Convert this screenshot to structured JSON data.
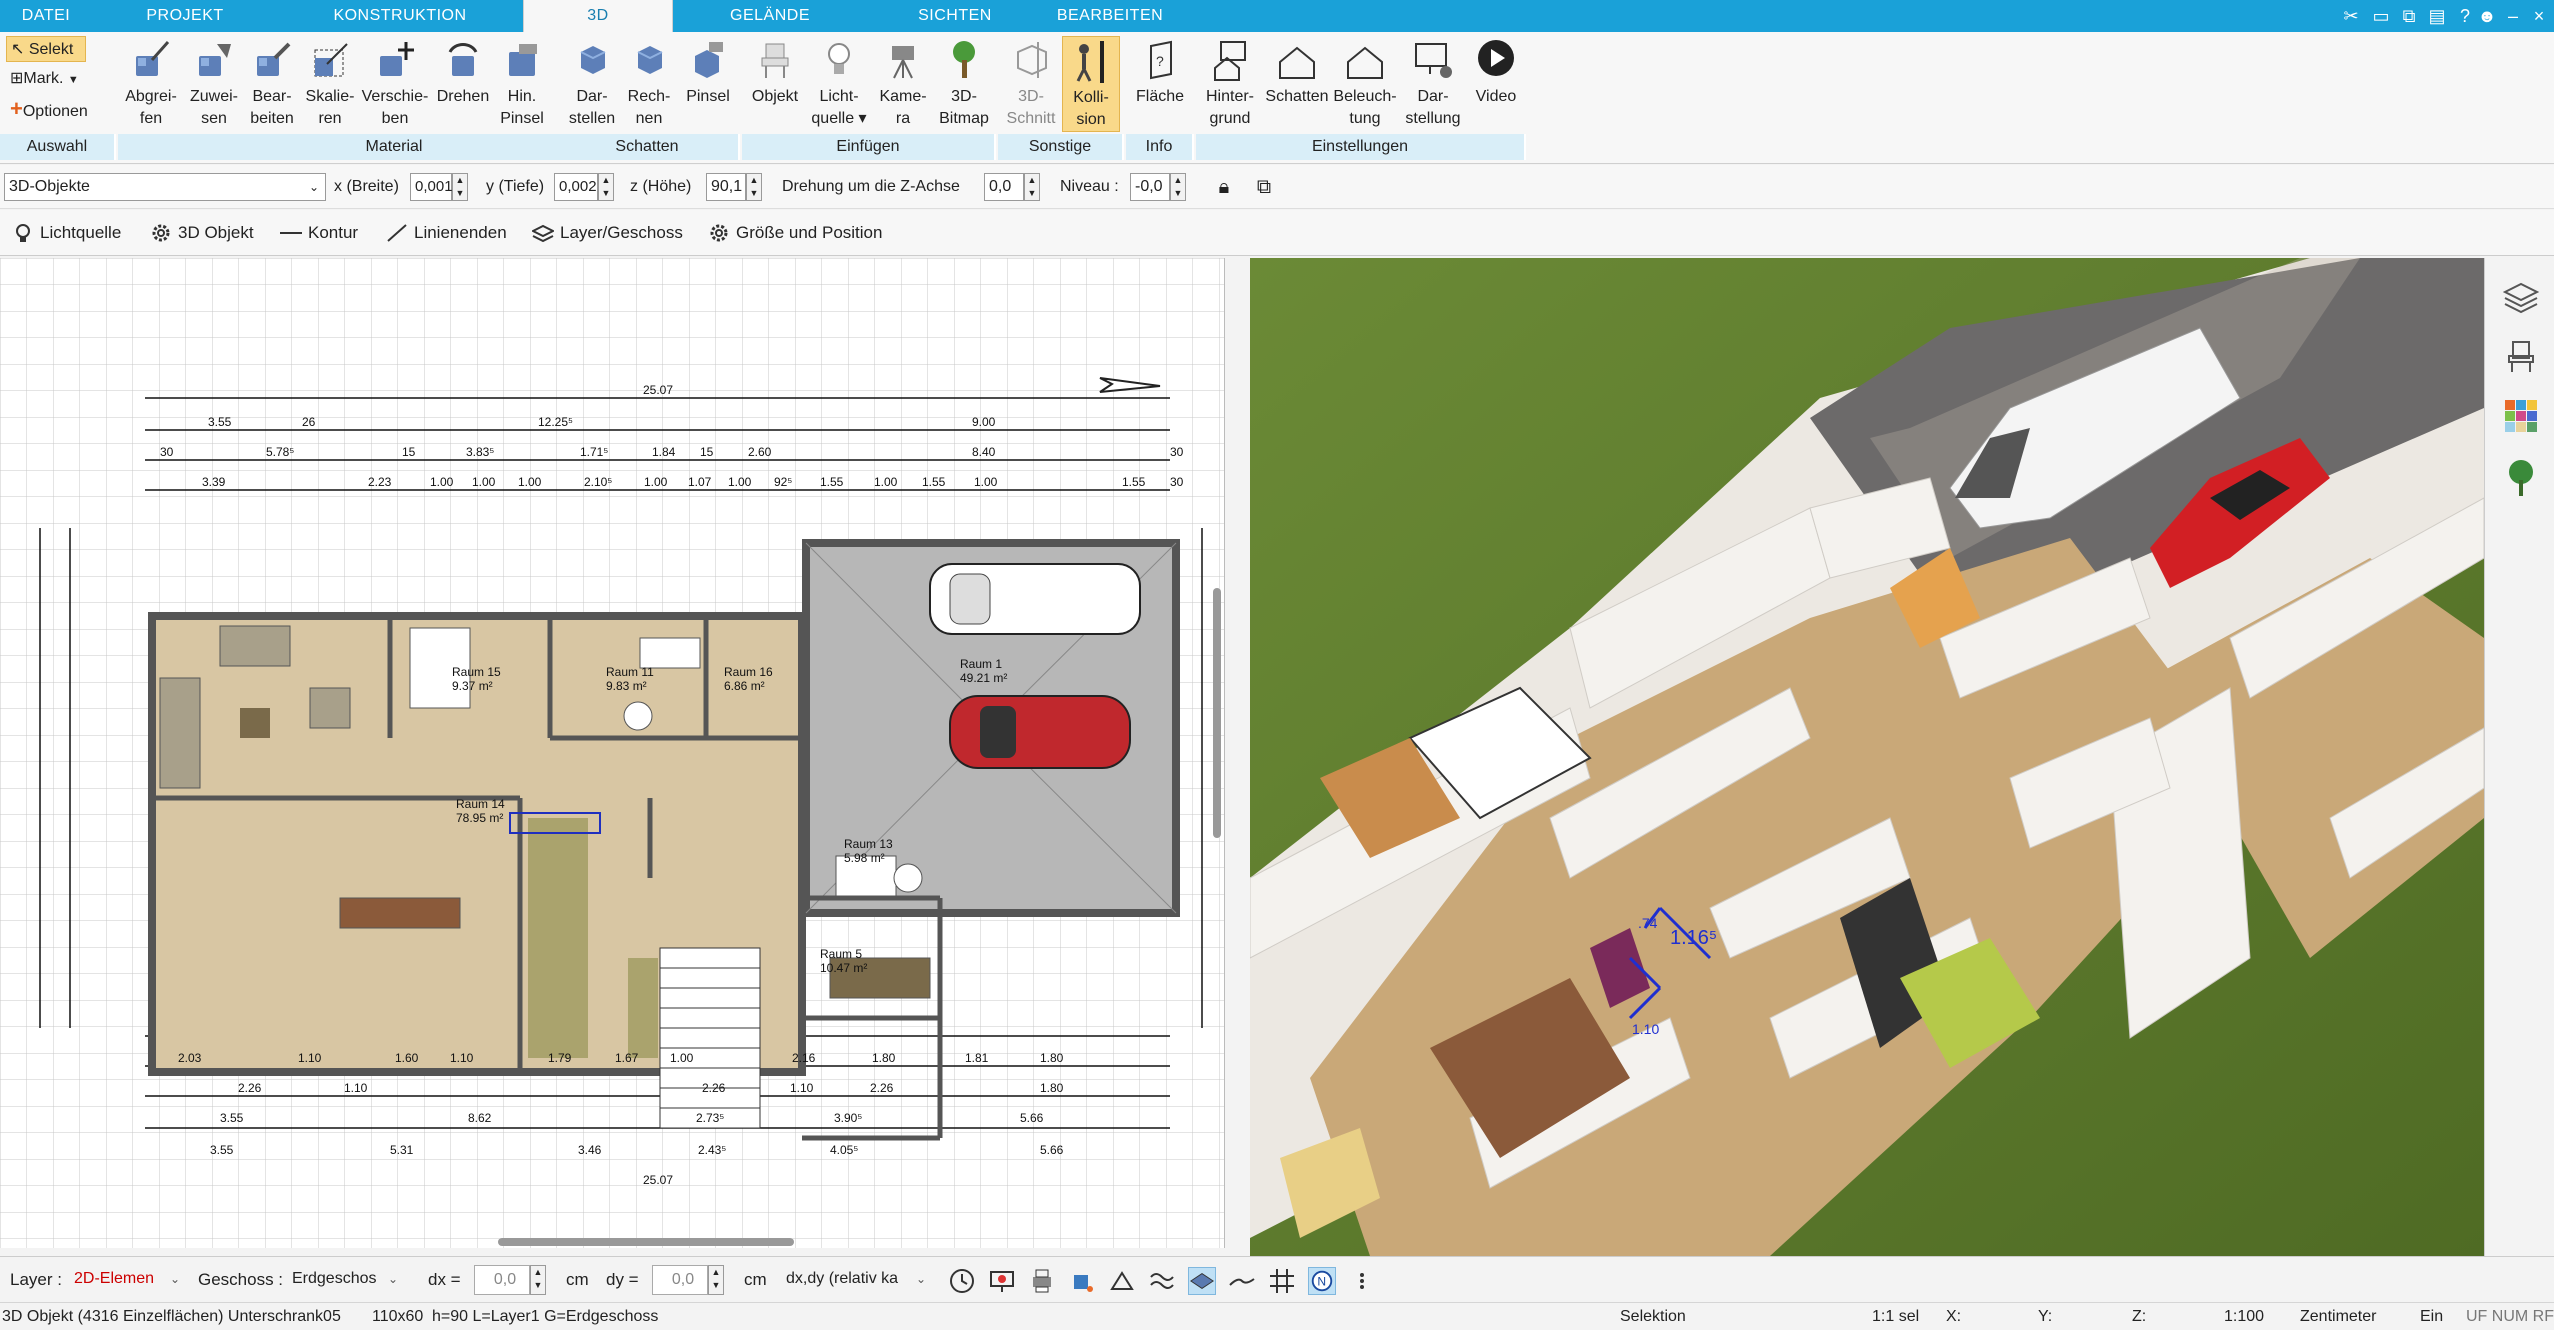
{
  "tabs": [
    {
      "label": "DATEI"
    },
    {
      "label": "PROJEKT"
    },
    {
      "label": "KONSTRUKTION"
    },
    {
      "label": "3D"
    },
    {
      "label": "GELÄNDE"
    },
    {
      "label": "SICHTEN"
    },
    {
      "label": "BEARBEITEN"
    }
  ],
  "auswahl": {
    "selekt": "Selekt",
    "mark": "Mark.",
    "optionen": "Optionen",
    "group": "Auswahl"
  },
  "ribbon": {
    "material": {
      "group": "Material",
      "buttons": [
        {
          "line1": "Abgrei-",
          "line2": "fen",
          "icon": "eyedropper-icon"
        },
        {
          "line1": "Zuwei-",
          "line2": "sen",
          "icon": "assign-icon"
        },
        {
          "line1": "Bear-",
          "line2": "beiten",
          "icon": "edit-icon"
        },
        {
          "line1": "Skalie-",
          "line2": "ren",
          "icon": "scale-icon"
        },
        {
          "line1": "Verschie-",
          "line2": "ben",
          "icon": "move-icon"
        },
        {
          "line1": "Drehen",
          "line2": "",
          "icon": "rotate-icon"
        },
        {
          "line1": "Hin.",
          "line2": "Pinsel",
          "icon": "brush-icon"
        }
      ]
    },
    "schatten": {
      "group": "Schatten",
      "buttons": [
        {
          "line1": "Dar-",
          "line2": "stellen",
          "icon": "cube-shadow-icon"
        },
        {
          "line1": "Rech-",
          "line2": "nen",
          "icon": "cube-calc-icon"
        },
        {
          "line1": "Pinsel",
          "line2": "",
          "icon": "cube-brush-icon"
        }
      ]
    },
    "einfuegen": {
      "group": "Einfügen",
      "buttons": [
        {
          "line1": "Objekt",
          "line2": "",
          "icon": "chair-icon"
        },
        {
          "line1": "Licht-",
          "line2": "quelle ▾",
          "icon": "lightbulb-icon"
        },
        {
          "line1": "Kame-",
          "line2": "ra",
          "icon": "camera-icon"
        },
        {
          "line1": "3D-",
          "line2": "Bitmap",
          "icon": "tree-icon"
        }
      ]
    },
    "sonstige": {
      "group": "Sonstige",
      "buttons": [
        {
          "line1": "3D-",
          "line2": "Schnitt",
          "icon": "section-icon"
        },
        {
          "line1": "Kolli-",
          "line2": "sion",
          "icon": "collision-icon"
        }
      ]
    },
    "info": {
      "group": "Info",
      "buttons": [
        {
          "line1": "Fläche",
          "line2": "",
          "icon": "area-icon"
        }
      ]
    },
    "einstellungen": {
      "group": "Einstellungen",
      "buttons": [
        {
          "line1": "Hinter-",
          "line2": "grund",
          "icon": "background-icon"
        },
        {
          "line1": "Schatten",
          "line2": "",
          "icon": "house-shadow-icon"
        },
        {
          "line1": "Beleuch-",
          "line2": "tung",
          "icon": "house-light-icon"
        },
        {
          "line1": "Dar-",
          "line2": "stellung",
          "icon": "display-icon"
        },
        {
          "line1": "Video",
          "line2": "",
          "icon": "play-icon"
        }
      ]
    }
  },
  "properties": {
    "category": "3D-Objekte",
    "x_label": "x (Breite)",
    "x_value": "0,001",
    "y_label": "y (Tiefe)",
    "y_value": "0,002",
    "z_label": "z (Höhe)",
    "z_value": "90,1",
    "rotation_label": "Drehung um die Z-Achse",
    "rotation_value": "0,0",
    "niveau_label": "Niveau :",
    "niveau_value": "-0,0"
  },
  "subtabs": [
    {
      "label": "Lichtquelle",
      "icon": "lightbulb-icon"
    },
    {
      "label": "3D Objekt",
      "icon": "gear-icon"
    },
    {
      "label": "Kontur",
      "icon": "line-icon"
    },
    {
      "label": "Linienenden",
      "icon": "line-end-icon"
    },
    {
      "label": "Layer/Geschoss",
      "icon": "layers-icon"
    },
    {
      "label": "Größe und Position",
      "icon": "gear-icon"
    }
  ],
  "plan": {
    "dims_top": [
      "25.07",
      "3.55",
      "26",
      "12.25⁵",
      "9.00",
      "30",
      "5.78⁵",
      "15",
      "3.83⁵",
      "1.71⁵",
      "1.84",
      "15",
      "2.60",
      "8.40",
      "30",
      "3.39",
      "2.23",
      "1.00",
      "1.00",
      "1.00",
      "2.10⁵",
      "1.00",
      "1.07",
      "1.00",
      "92⁵",
      "1.55",
      "1.00",
      "1.55",
      "1.00",
      "1.55",
      "30"
    ],
    "dims_bottom": [
      "2.03",
      "1.10",
      "1.60",
      "1.10",
      "1.79",
      "1.67",
      "1.00",
      "2.16",
      "1.80",
      "1.81",
      "1.80",
      "2.26",
      "1.10",
      "2.26",
      "1.10",
      "2.26",
      "1.80",
      "3.55",
      "8.62",
      "5.66",
      "2.73⁵",
      "3.90⁵",
      "3.55",
      "5.31",
      "3.46",
      "2.43⁵",
      "4.05⁵",
      "5.66",
      "25.07"
    ],
    "rooms": [
      {
        "name": "Raum 15",
        "area": "9.37 m²"
      },
      {
        "name": "Raum 11",
        "area": "9.83 m²"
      },
      {
        "name": "Raum 16",
        "area": "6.86 m²"
      },
      {
        "name": "Raum 1",
        "area": "49.21 m²"
      },
      {
        "name": "Raum 14",
        "area": "78.95 m²"
      },
      {
        "name": "Raum 13",
        "area": "5.98 m²"
      },
      {
        "name": "Raum 5",
        "area": "10.47 m²"
      }
    ]
  },
  "view3d": {
    "dim1": "1.16⁵",
    "dim2": "1.10",
    "dim3": ".74"
  },
  "bottom": {
    "layer_label": "Layer :",
    "layer_value": "2D-Elemen",
    "geschoss_label": "Geschoss :",
    "geschoss_value": "Erdgeschos",
    "dx_label": "dx =",
    "dx_value": "0,0",
    "dx_unit": "cm",
    "dy_label": "dy =",
    "dy_value": "0,0",
    "dy_unit": "cm",
    "mode_value": "dx,dy (relativ ka"
  },
  "status": {
    "object": "3D Objekt (4316 Einzelflächen) Unterschrank05",
    "size": "110x60",
    "meta": "h=90 L=Layer1 G=Erdgeschoss",
    "selektion": "Selektion",
    "sel": "1:1 sel",
    "x": "X:",
    "y": "Y:",
    "z": "Z:",
    "scale": "1:100",
    "unit": "Zentimeter",
    "ein": "Ein",
    "flags": "UF NUM RF"
  },
  "colors": {
    "tabbar": "#1aa1d8",
    "group_label": "#d9eef8",
    "active_button": "#f9d98a",
    "grass": "#5e7a2e",
    "floor": "#c9a878"
  }
}
